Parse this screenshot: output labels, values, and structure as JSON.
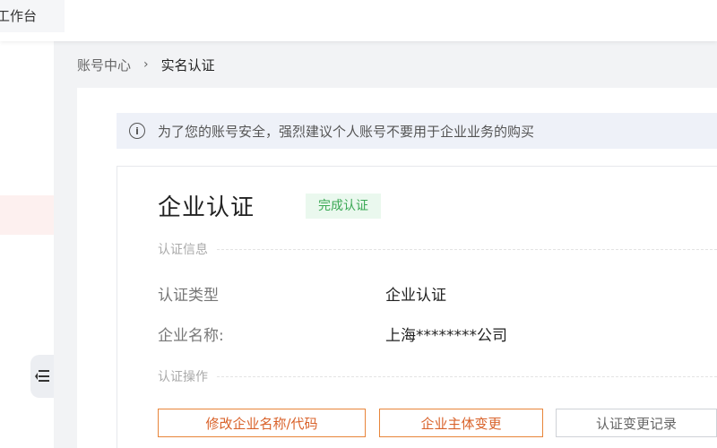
{
  "header": {
    "workbench_label": "工作台"
  },
  "breadcrumb": {
    "parent": "账号中心",
    "separator": "›",
    "current": "实名认证"
  },
  "notice": {
    "icon": "info-icon",
    "text": "为了您的账号安全，强烈建议个人账号不要用于企业业务的购买"
  },
  "card": {
    "title": "企业认证",
    "status": "完成认证",
    "info_section": "认证信息",
    "fields": [
      {
        "label": "认证类型",
        "value": "企业认证"
      },
      {
        "label": "企业名称:",
        "value": "上海********公司"
      }
    ],
    "ops_section": "认证操作",
    "buttons": {
      "modify": "修改企业名称/代码",
      "change_subject": "企业主体变更",
      "history": "认证变更记录"
    }
  },
  "colors": {
    "accent_orange": "#e8853a",
    "status_green": "#3aa854",
    "status_green_bg": "#eaf8ee",
    "notice_bg": "#eef1f8",
    "sidebar_active_bg": "#fdf0ef"
  }
}
